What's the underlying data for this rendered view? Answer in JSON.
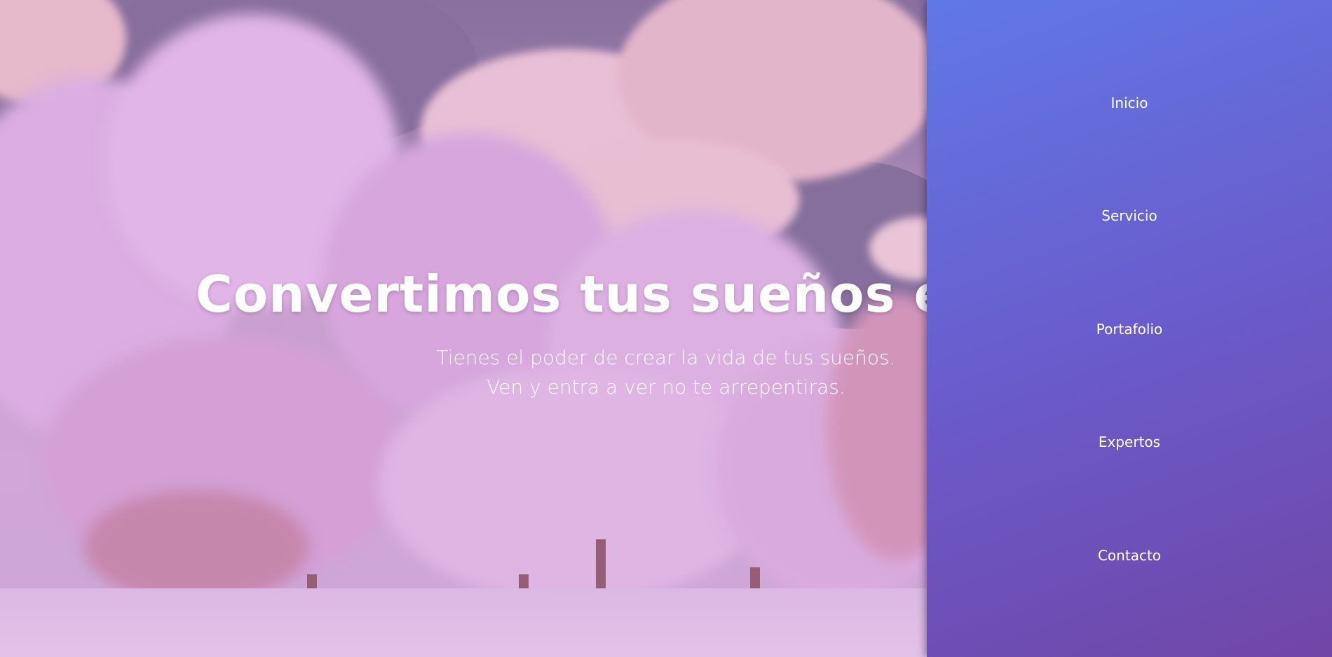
{
  "hero": {
    "title": "Convertimos tus sueños en realidad",
    "subtitle_line1": "Tienes el poder de crear la vida de tus sueños.",
    "subtitle_line2": "Ven y entra a ver no te arrepentiras."
  },
  "nav": {
    "items": [
      {
        "label": "Inicio"
      },
      {
        "label": "Servicio"
      },
      {
        "label": "Portafolio"
      },
      {
        "label": "Expertos"
      },
      {
        "label": "Contacto"
      }
    ]
  },
  "colors": {
    "sidebar_gradient_start": "#6078e6",
    "sidebar_gradient_end": "#7046a6",
    "hero_text": "#ffffff"
  }
}
